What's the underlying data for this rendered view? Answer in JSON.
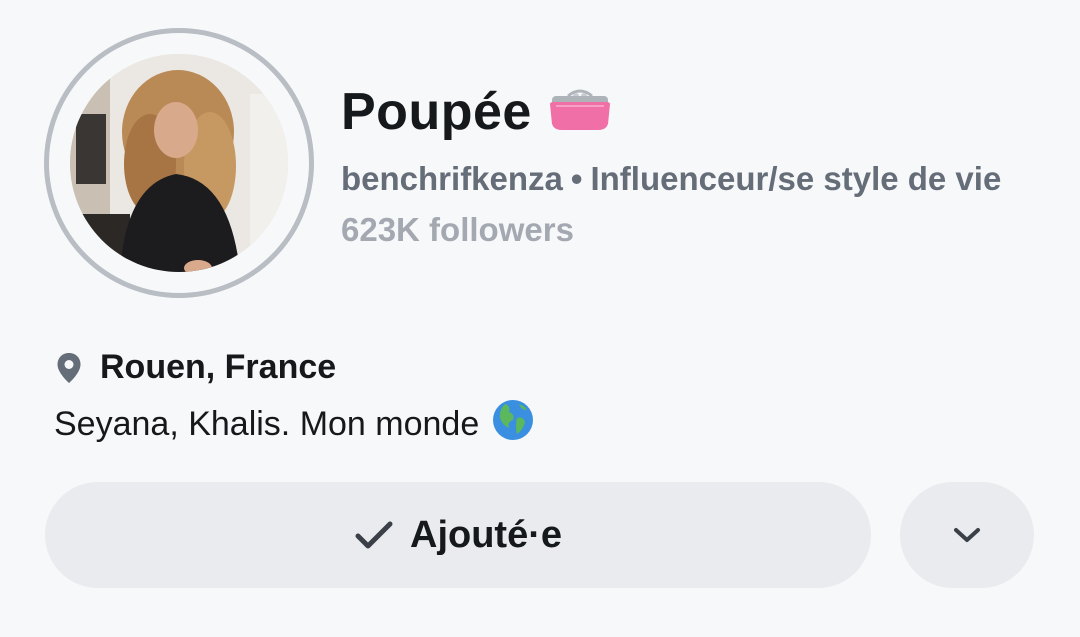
{
  "profile": {
    "display_name": "Poupée",
    "display_name_emoji": "purse-emoji",
    "username": "benchrifkenza",
    "separator": "•",
    "category": "Influenceur/se style de vie",
    "followers": "623K followers",
    "location": "Rouen, France",
    "bio": "Seyana, Khalis. Mon monde",
    "bio_emoji": "globe-europe-africa-emoji"
  },
  "actions": {
    "added_label": "Ajouté·e",
    "added_icon": "checkmark-icon",
    "more_icon": "chevron-down-icon"
  },
  "colors": {
    "background": "#f7f8fa",
    "button_bg": "#e9ebee",
    "ring": "#b9bdc4",
    "subtitle": "#656d78",
    "followers": "#a3a8b1"
  }
}
